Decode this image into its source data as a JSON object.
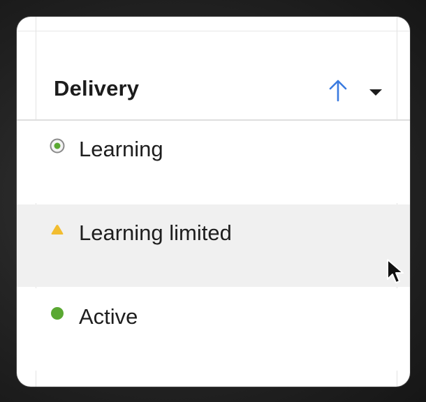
{
  "column": {
    "title": "Delivery",
    "sort_icon": "arrow-up-icon",
    "menu_icon": "caret-down-icon",
    "accent_color": "#3b7be0"
  },
  "rows": [
    {
      "label": "Learning",
      "status_icon": "learning-radio-icon",
      "icon_color": "#5aa832"
    },
    {
      "label": "Learning limited",
      "status_icon": "warning-triangle-icon",
      "icon_color": "#f2bd30"
    },
    {
      "label": "Active",
      "status_icon": "active-dot-icon",
      "icon_color": "#5aa832"
    }
  ]
}
